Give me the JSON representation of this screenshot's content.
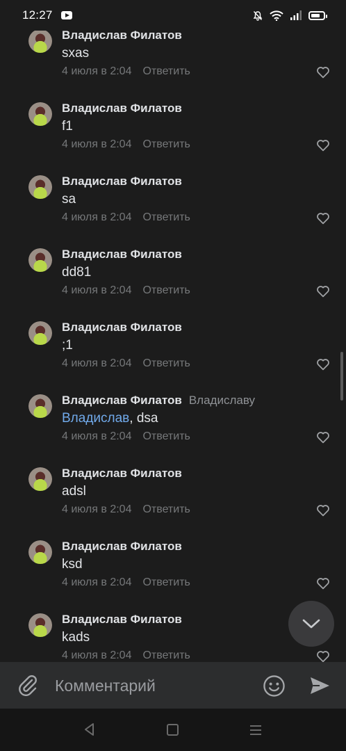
{
  "status_bar": {
    "time": "12:27",
    "icons": [
      "youtube-icon",
      "bell-off-icon",
      "wifi-icon",
      "signal-icon",
      "battery-icon"
    ]
  },
  "comments": [
    {
      "author": "Владислав Филатов",
      "text": "sxas",
      "date": "4 июля в 2:04",
      "reply_label": "Ответить"
    },
    {
      "author": "Владислав Филатов",
      "text": "f1",
      "date": "4 июля в 2:04",
      "reply_label": "Ответить"
    },
    {
      "author": "Владислав Филатов",
      "text": "sa",
      "date": "4 июля в 2:04",
      "reply_label": "Ответить"
    },
    {
      "author": "Владислав Филатов",
      "text": "dd81",
      "date": "4 июля в 2:04",
      "reply_label": "Ответить"
    },
    {
      "author": "Владислав Филатов",
      "text": ";1",
      "date": "4 июля в 2:04",
      "reply_label": "Ответить"
    },
    {
      "author": "Владислав Филатов",
      "reply_to": "Владиславу",
      "mention": "Владислав",
      "text": ", dsa",
      "date": "4 июля в 2:04",
      "reply_label": "Ответить"
    },
    {
      "author": "Владислав Филатов",
      "text": "adsl",
      "date": "4 июля в 2:04",
      "reply_label": "Ответить"
    },
    {
      "author": "Владислав Филатов",
      "text": "ksd",
      "date": "4 июля в 2:04",
      "reply_label": "Ответить"
    },
    {
      "author": "Владислав Филатов",
      "text": "kads",
      "date": "4 июля в 2:04",
      "reply_label": "Ответить"
    }
  ],
  "input": {
    "placeholder": "Комментарий",
    "value": ""
  },
  "colors": {
    "background": "#1c1c1c",
    "input_bar": "#2c2d2e",
    "mention": "#71aaeb",
    "secondary_text": "#76787a"
  }
}
